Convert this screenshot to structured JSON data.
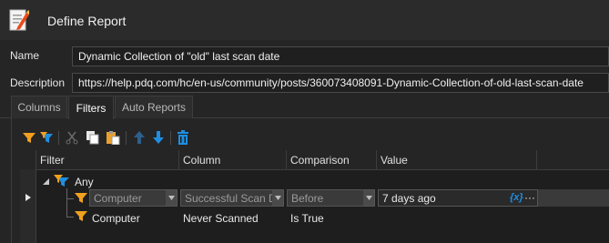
{
  "window": {
    "title": "Define Report"
  },
  "form": {
    "name_label": "Name",
    "name_value": "Dynamic Collection of \"old\" last scan date",
    "description_label": "Description",
    "description_value": "https://help.pdq.com/hc/en-us/community/posts/360073408091-Dynamic-Collection-of-old-last-scan-date"
  },
  "tabs": [
    {
      "label": "Columns",
      "active": false
    },
    {
      "label": "Filters",
      "active": true
    },
    {
      "label": "Auto Reports",
      "active": false
    }
  ],
  "toolbar": {
    "icons": [
      "add-filter-icon",
      "add-filter-group-icon",
      "cut-icon",
      "copy-icon",
      "paste-icon",
      "move-up-icon",
      "move-down-icon",
      "delete-icon"
    ]
  },
  "grid": {
    "headers": [
      "Filter",
      "Column",
      "Comparison",
      "Value"
    ],
    "group": {
      "label": "Any"
    },
    "rows": [
      {
        "filter": "Computer",
        "column": "Successful Scan Date",
        "comparison": "Before",
        "value": "7 days ago",
        "editing": true,
        "expression_token": "{x}",
        "ellipsis": "···"
      },
      {
        "filter": "Computer",
        "column": "Never Scanned",
        "comparison": "Is True",
        "value": "",
        "editing": false
      }
    ]
  },
  "colors": {
    "accent": "#1e8fe0",
    "filter_orange": "#f0a020",
    "background": "#252526",
    "grid_bg": "#1e1e1e"
  }
}
